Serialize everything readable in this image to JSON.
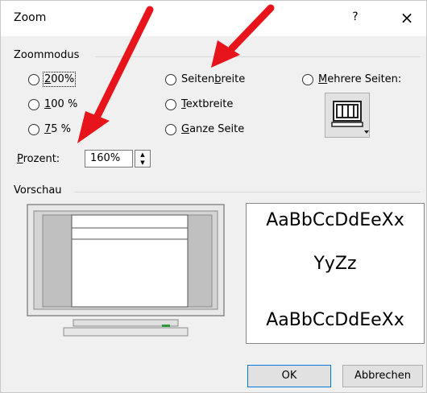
{
  "window": {
    "title": "Zoom",
    "help": "?",
    "close": "×"
  },
  "zoommodus": {
    "label": "Zoommodus",
    "left_options": [
      {
        "label": "200%",
        "accel": "2",
        "rest": "00%",
        "focused": true
      },
      {
        "label": "100 %",
        "accel": "1",
        "rest": "00 %"
      },
      {
        "label": "75 %",
        "accel": "7",
        "rest": "5 %"
      }
    ],
    "middle_options": [
      {
        "label": "Seitenbreite",
        "before": "Seiten",
        "accel": "b",
        "after": "reite"
      },
      {
        "label": "Textbreite",
        "before": "",
        "accel": "T",
        "after": "extbreite"
      },
      {
        "label": "Ganze Seite",
        "before": "",
        "accel": "G",
        "after": "anze Seite"
      }
    ],
    "multi_pages": {
      "label": "Mehrere Seiten:",
      "accel": "M",
      "after": "ehrere Seiten:",
      "icon": "multi-page-monitor-icon"
    },
    "percent": {
      "label": "Prozent:",
      "accel": "P",
      "after": "rozent:",
      "value": "160%"
    }
  },
  "vorschau": {
    "label": "Vorschau",
    "sample_lines": [
      "AaBbCcDdEeXx",
      "YyZz",
      "AaBbCcDdEeXx"
    ]
  },
  "buttons": {
    "ok": "OK",
    "cancel": "Abbrechen"
  },
  "annotation_color": "#e8141c"
}
